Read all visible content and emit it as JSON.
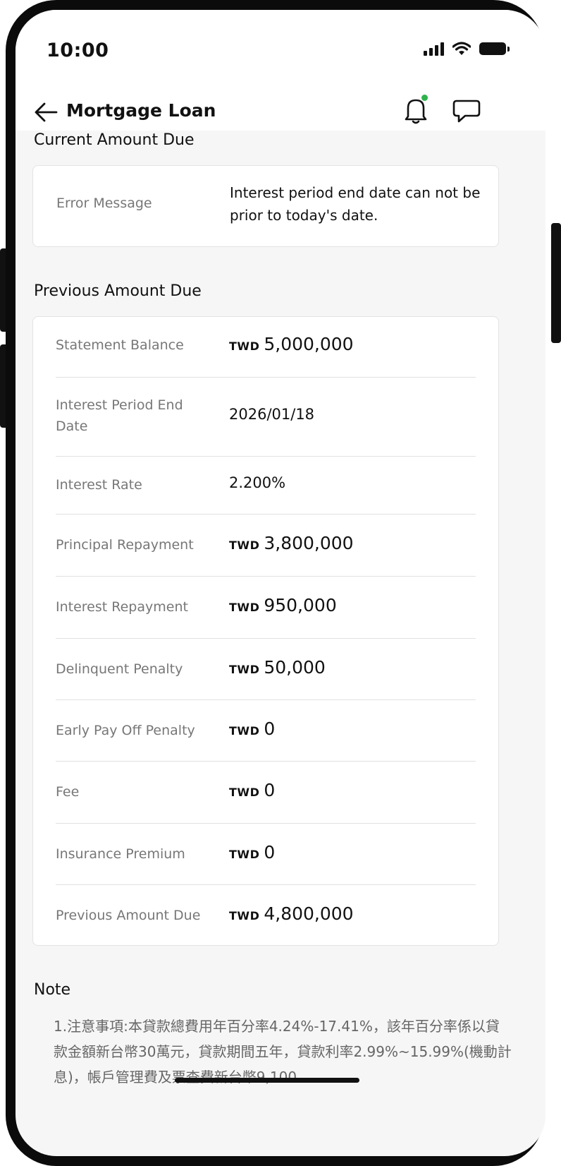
{
  "status_bar": {
    "time": "10:00"
  },
  "header": {
    "title": "Mortgage Loan"
  },
  "current_amount_due": {
    "title": "Current Amount Due",
    "error_label": "Error Message",
    "error_message": "Interest period end date can not be prior to today's date."
  },
  "previous_amount_due": {
    "title": "Previous Amount Due",
    "rows": [
      {
        "label": "Statement Balance",
        "currency": "TWD",
        "value": "5,000,000"
      },
      {
        "label": "Interest Period End Date",
        "currency": "",
        "value": "2026/01/18"
      },
      {
        "label": "Interest Rate",
        "currency": "",
        "value": "2.200%"
      },
      {
        "label": "Principal Repayment",
        "currency": "TWD",
        "value": "3,800,000"
      },
      {
        "label": "Interest Repayment",
        "currency": "TWD",
        "value": "950,000"
      },
      {
        "label": "Delinquent Penalty",
        "currency": "TWD",
        "value": "50,000"
      },
      {
        "label": "Early Pay Off Penalty",
        "currency": "TWD",
        "value": "0"
      },
      {
        "label": "Fee",
        "currency": "TWD",
        "value": "0"
      },
      {
        "label": "Insurance Premium",
        "currency": "TWD",
        "value": "0"
      },
      {
        "label": "Previous Amount Due",
        "currency": "TWD",
        "value": "4,800,000"
      }
    ]
  },
  "note": {
    "title": "Note",
    "text": "1.注意事項:本貸款總費用年百分率4.24%-17.41%，該年百分率係以貸款金額新台幣30萬元，貸款期間五年，貸款利率2.99%~15.99%(機動計息)，帳戶管理費及票查費新台幣9,100..."
  },
  "colors": {
    "notification_dot": "#2fb24c"
  }
}
